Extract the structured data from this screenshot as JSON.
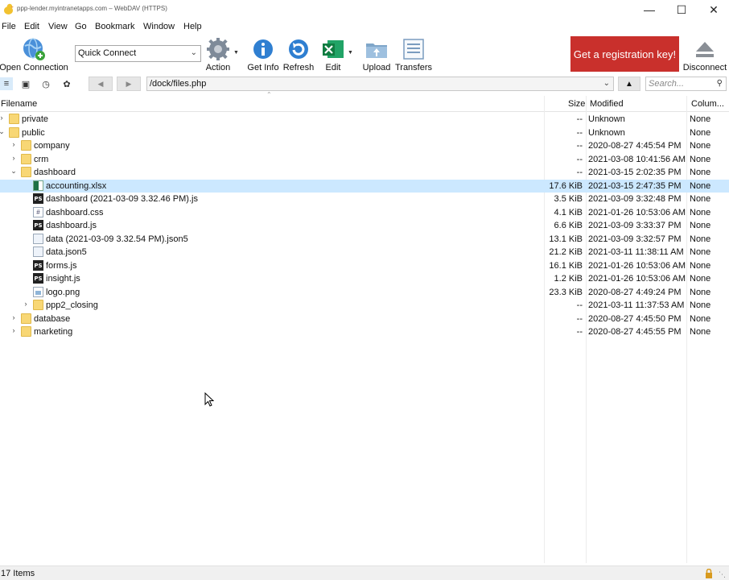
{
  "window": {
    "title": "ppp-lender.myintranetapps.com – WebDAV (HTTPS)",
    "minimize_icon": "minimize-icon",
    "maximize_icon": "maximize-icon",
    "close_icon": "close-icon"
  },
  "menu": [
    "File",
    "Edit",
    "View",
    "Go",
    "Bookmark",
    "Window",
    "Help"
  ],
  "toolbar": {
    "open_connection": "Open Connection",
    "quick_connect": "Quick Connect",
    "action": "Action",
    "get_info": "Get Info",
    "refresh": "Refresh",
    "edit": "Edit",
    "upload": "Upload",
    "transfers": "Transfers",
    "registration": "Get a registration key!",
    "disconnect": "Disconnect",
    "registration_color": "#c9302c"
  },
  "pathbar": {
    "path": "/dock/files.php",
    "search_placeholder": "Search..."
  },
  "columns": {
    "filename": "Filename",
    "size": "Size",
    "modified": "Modified",
    "extra": "Colum..."
  },
  "files": [
    {
      "name": "private",
      "size": "--",
      "modified": "Unknown",
      "col": "None"
    },
    {
      "name": "public",
      "size": "--",
      "modified": "Unknown",
      "col": "None"
    },
    {
      "name": "company",
      "size": "--",
      "modified": "2020-08-27 4:45:54 PM",
      "col": "None"
    },
    {
      "name": "crm",
      "size": "--",
      "modified": "2021-03-08 10:41:56 AM",
      "col": "None"
    },
    {
      "name": "dashboard",
      "size": "--",
      "modified": "2021-03-15 2:02:35 PM",
      "col": "None"
    },
    {
      "name": "accounting.xlsx",
      "size": "17.6 KiB",
      "modified": "2021-03-15 2:47:35 PM",
      "col": "None"
    },
    {
      "name": "dashboard (2021-03-09 3.32.46 PM).js",
      "size": "3.5 KiB",
      "modified": "2021-03-09 3:32:48 PM",
      "col": "None"
    },
    {
      "name": "dashboard.css",
      "size": "4.1 KiB",
      "modified": "2021-01-26 10:53:06 AM",
      "col": "None"
    },
    {
      "name": "dashboard.js",
      "size": "6.6 KiB",
      "modified": "2021-03-09 3:33:37 PM",
      "col": "None"
    },
    {
      "name": "data (2021-03-09 3.32.54 PM).json5",
      "size": "13.1 KiB",
      "modified": "2021-03-09 3:32:57 PM",
      "col": "None"
    },
    {
      "name": "data.json5",
      "size": "21.2 KiB",
      "modified": "2021-03-11 11:38:11 AM",
      "col": "None"
    },
    {
      "name": "forms.js",
      "size": "16.1 KiB",
      "modified": "2021-01-26 10:53:06 AM",
      "col": "None"
    },
    {
      "name": "insight.js",
      "size": "1.2 KiB",
      "modified": "2021-01-26 10:53:06 AM",
      "col": "None"
    },
    {
      "name": "logo.png",
      "size": "23.3 KiB",
      "modified": "2020-08-27 4:49:24 PM",
      "col": "None"
    },
    {
      "name": "ppp2_closing",
      "size": "--",
      "modified": "2021-03-11 11:37:53 AM",
      "col": "None"
    },
    {
      "name": "database",
      "size": "--",
      "modified": "2020-08-27 4:45:50 PM",
      "col": "None"
    },
    {
      "name": "marketing",
      "size": "--",
      "modified": "2020-08-27 4:45:55 PM",
      "col": "None"
    }
  ],
  "status": {
    "count": "17 Items"
  }
}
